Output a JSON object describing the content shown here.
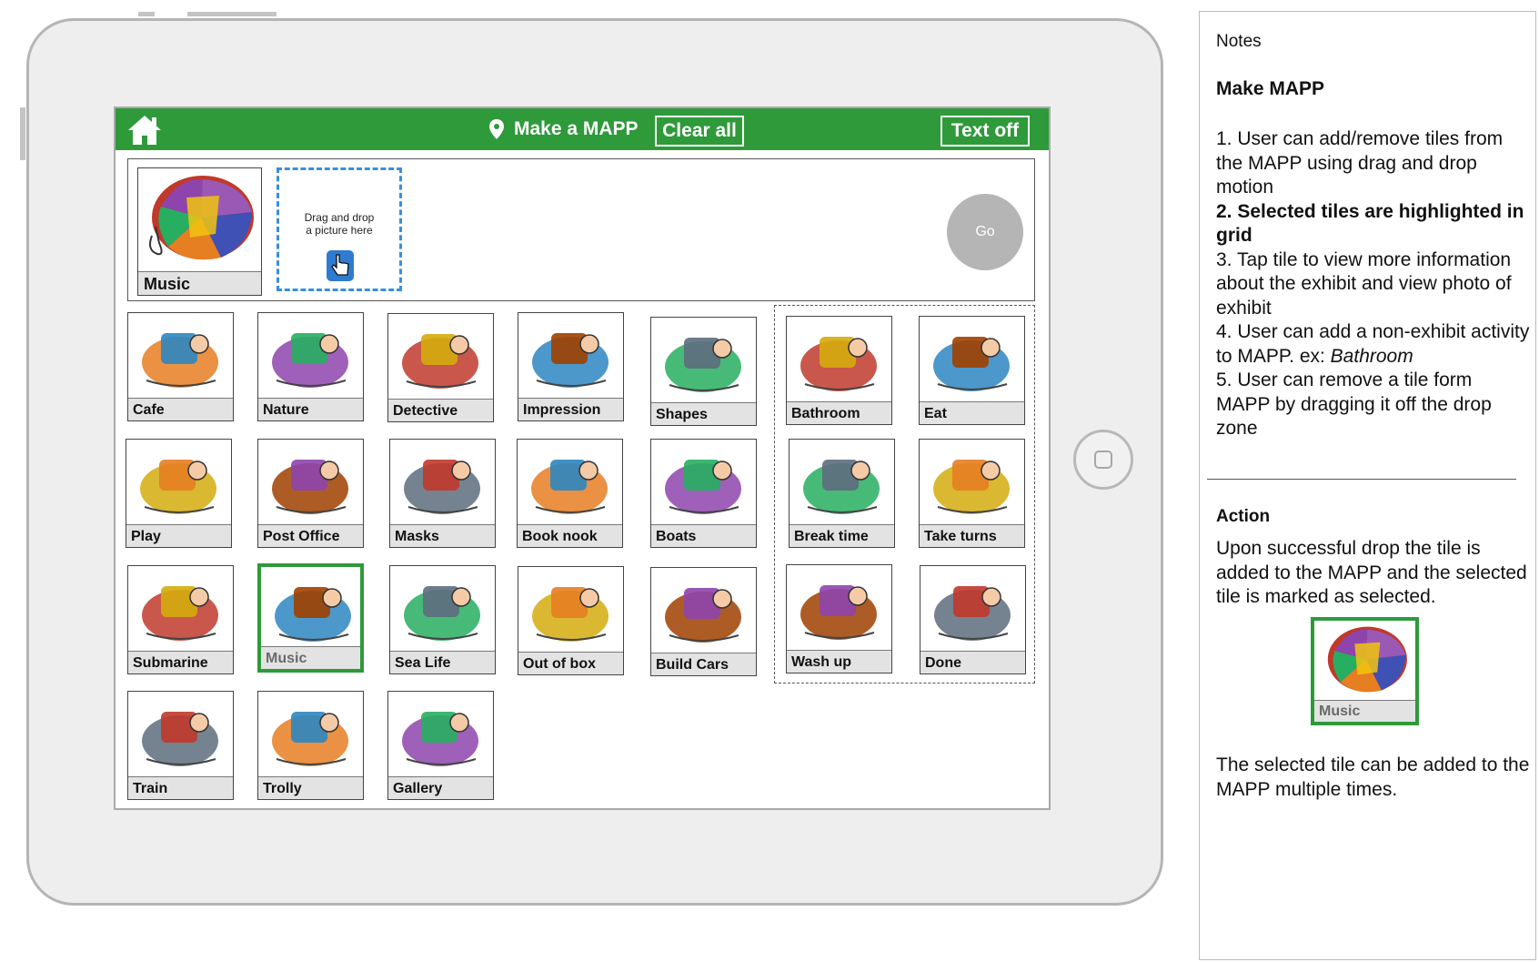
{
  "header": {
    "title": "Make a MAPP",
    "clear_all_label": "Clear all",
    "text_off_label": "Text off",
    "brand_color": "#2e9a3a"
  },
  "mapp_strip": {
    "selected_tile_label": "Music",
    "dropzone_line1": "Drag and drop",
    "dropzone_line2": "a picture here",
    "go_label": "Go"
  },
  "exhibit_tiles": [
    {
      "label": "Cafe",
      "icon": "cafe-icon"
    },
    {
      "label": "Nature",
      "icon": "beaver-icon"
    },
    {
      "label": "Detective",
      "icon": "detective-icon"
    },
    {
      "label": "Impression",
      "icon": "press-icon"
    },
    {
      "label": "Shapes",
      "icon": "shapes-icon"
    },
    {
      "label": "Play",
      "icon": "play-icon"
    },
    {
      "label": "Post Office",
      "icon": "mailbox-icon"
    },
    {
      "label": "Masks",
      "icon": "mask-icon"
    },
    {
      "label": "Book nook",
      "icon": "cat-book-icon"
    },
    {
      "label": "Boats",
      "icon": "boat-icon"
    },
    {
      "label": "Submarine",
      "icon": "submarine-icon"
    },
    {
      "label": "Music",
      "icon": "music-icon",
      "selected": true
    },
    {
      "label": "Sea Life",
      "icon": "sea-life-icon"
    },
    {
      "label": "Out of box",
      "icon": "box-icon"
    },
    {
      "label": "Build Cars",
      "icon": "race-car-icon"
    },
    {
      "label": "Train",
      "icon": "train-icon"
    },
    {
      "label": "Trolly",
      "icon": "trolly-icon"
    },
    {
      "label": "Gallery",
      "icon": "gallery-icon"
    }
  ],
  "activity_tiles": [
    {
      "label": "Bathroom",
      "icon": "bathroom-icon"
    },
    {
      "label": "Eat",
      "icon": "eat-icon"
    },
    {
      "label": "Break time",
      "icon": "break-time-icon"
    },
    {
      "label": "Take turns",
      "icon": "take-turns-icon"
    },
    {
      "label": "Wash up",
      "icon": "wash-hands-icon"
    },
    {
      "label": "Done",
      "icon": "stop-sign-icon"
    }
  ],
  "notes": {
    "header": "Notes",
    "section_title": "Make MAPP",
    "items": [
      "1. User can add/remove tiles from the MAPP using drag and drop motion",
      "2. Selected tiles are highlighted in grid",
      "3. Tap tile to view more information about the exhibit and view photo of exhibit",
      "4. User can add a non-exhibit activity to MAPP. ex: ",
      "Bathroom",
      "5. User can remove a tile form MAPP by dragging it off the drop zone"
    ],
    "action_title": "Action",
    "action_text": "Upon successful drop the tile is added to the MAPP and the selected tile is marked as selected.",
    "example_tile_label": "Music",
    "action_text2": "The selected tile can be added to the MAPP multiple times."
  }
}
